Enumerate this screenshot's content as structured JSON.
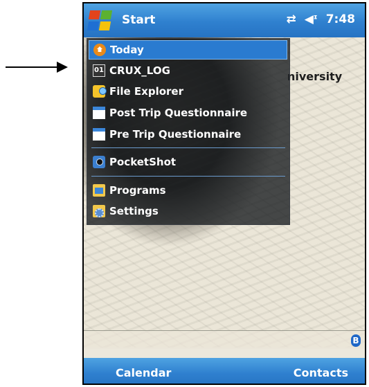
{
  "titlebar": {
    "start_label": "Start",
    "time": "7:48",
    "sync_icon": "sync-arrows-icon",
    "volume_icon": "speaker-icon"
  },
  "background": {
    "owner_text": "niversity"
  },
  "start_menu": {
    "items": [
      {
        "label": "Today",
        "icon": "today-icon",
        "selected": true
      },
      {
        "label": "CRUX_LOG",
        "icon": "calendar-01-icon"
      },
      {
        "label": "File Explorer",
        "icon": "file-explorer-icon"
      },
      {
        "label": "Post Trip Questionnaire",
        "icon": "form-icon"
      },
      {
        "label": "Pre Trip Questionnaire",
        "icon": "form-icon"
      },
      {
        "label": "PocketShot",
        "icon": "camera-icon"
      },
      {
        "label": "Programs",
        "icon": "programs-folder-icon"
      },
      {
        "label": "Settings",
        "icon": "settings-icon"
      }
    ]
  },
  "bottom": {
    "bluetooth_label": "B"
  },
  "softkeys": {
    "left": "Calendar",
    "right": "Contacts"
  },
  "colors": {
    "titlebar": "#2f80cf",
    "selection": "#2a7bd0",
    "menu_bg": "#161a1e"
  }
}
